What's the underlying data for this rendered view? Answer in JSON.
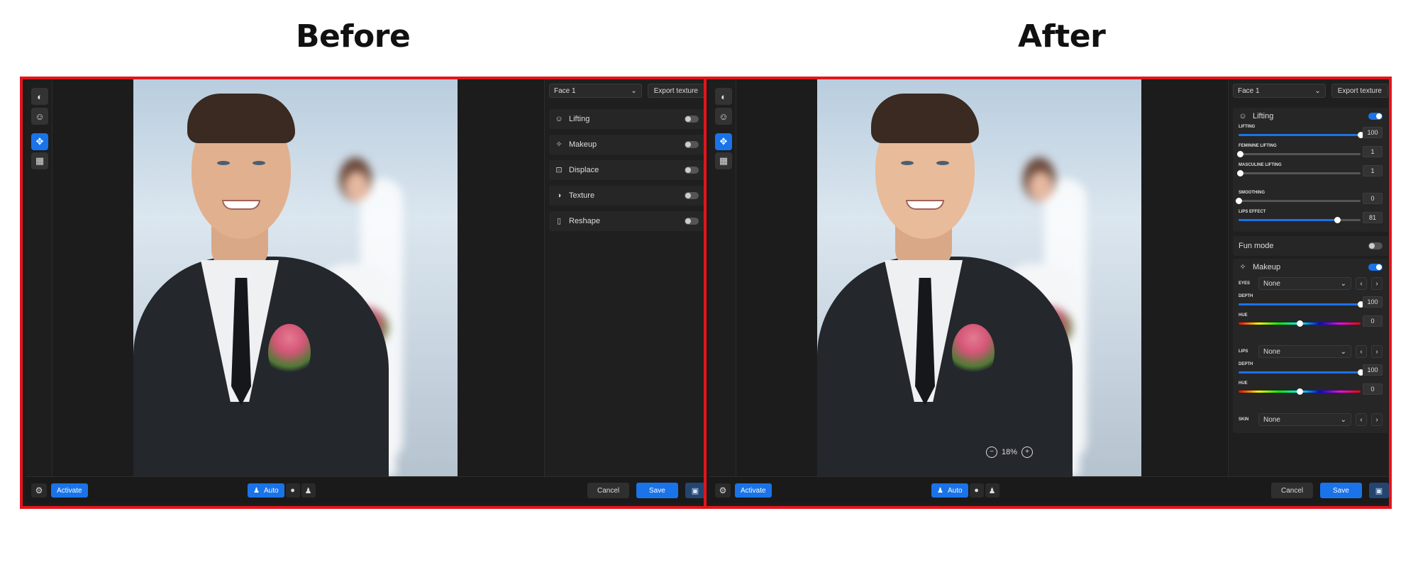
{
  "labels": {
    "before": "Before",
    "after": "After"
  },
  "toolbar": {
    "icons": [
      "mask-icon",
      "face-mesh-icon",
      "move-icon",
      "grid-icon"
    ]
  },
  "panel": {
    "face_select": "Face 1",
    "export_texture": "Export texture",
    "features": [
      {
        "label": "Lifting",
        "icon": "lifting-icon",
        "on": false
      },
      {
        "label": "Makeup",
        "icon": "sparkle-icon",
        "on": false
      },
      {
        "label": "Displace",
        "icon": "displace-icon",
        "on": false
      },
      {
        "label": "Texture",
        "icon": "texture-icon",
        "on": false
      },
      {
        "label": "Reshape",
        "icon": "reshape-icon",
        "on": false
      }
    ]
  },
  "after_panel": {
    "lifting": {
      "label": "Lifting",
      "on": true,
      "sliders": [
        {
          "label": "LIFTING",
          "value": "100",
          "fraction": 1.0
        },
        {
          "label": "FEMININE LIFTING",
          "value": "1",
          "fraction": 0.01
        },
        {
          "label": "MASCULINE LIFTING",
          "value": "1",
          "fraction": 0.01
        }
      ],
      "sliders2": [
        {
          "label": "SMOOTHING",
          "value": "0",
          "fraction": 0.0
        },
        {
          "label": "LIPS EFFECT",
          "value": "81",
          "fraction": 0.81
        }
      ]
    },
    "fun_mode": {
      "label": "Fun mode",
      "on": false
    },
    "makeup": {
      "label": "Makeup",
      "on": true,
      "eyes": {
        "label": "EYES",
        "value": "None",
        "depth": "100",
        "depth_fraction": 1.0,
        "hue": "0",
        "hue_fraction": 0.5
      },
      "lips": {
        "label": "LIPS",
        "value": "None",
        "depth": "100",
        "depth_fraction": 1.0,
        "hue": "0",
        "hue_fraction": 0.5
      },
      "skin": {
        "label": "SKIN",
        "value": "None"
      },
      "depth_label": "DEPTH",
      "hue_label": "HUE"
    },
    "zoom": "18%"
  },
  "bottom": {
    "activate": "Activate",
    "auto": "Auto",
    "cancel": "Cancel",
    "save": "Save"
  },
  "colors": {
    "accent": "#1a73e8",
    "frame": "#e4141c",
    "background": "#1c1c1c"
  }
}
